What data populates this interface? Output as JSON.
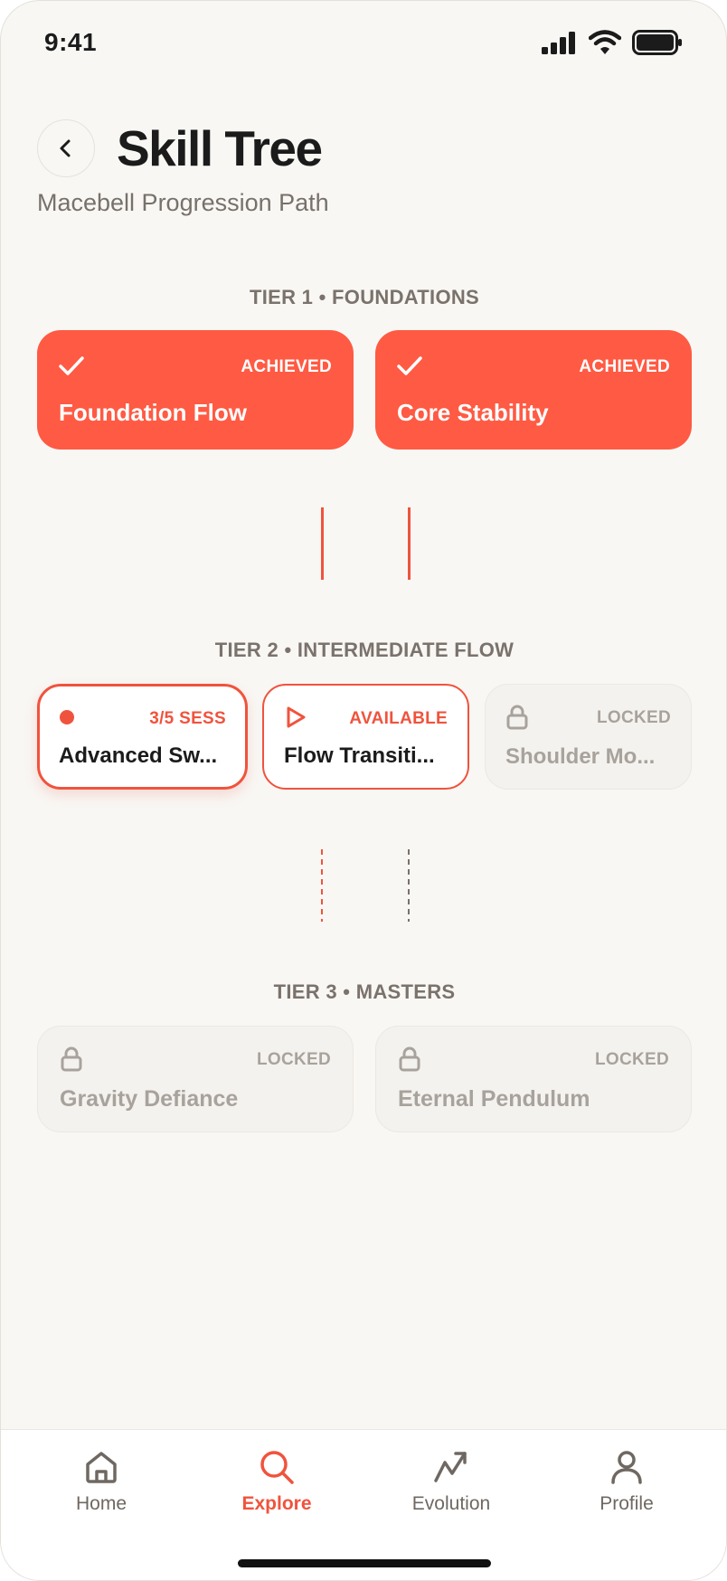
{
  "status_bar": {
    "time": "9:41"
  },
  "header": {
    "title": "Skill Tree",
    "subtitle": "Macebell Progression Path"
  },
  "tiers": [
    {
      "label": "TIER 1 • FOUNDATIONS",
      "cards": [
        {
          "title": "Foundation Flow",
          "status": "ACHIEVED",
          "state": "achieved",
          "icon": "check-icon"
        },
        {
          "title": "Core Stability",
          "status": "ACHIEVED",
          "state": "achieved",
          "icon": "check-icon"
        }
      ]
    },
    {
      "label": "TIER 2 • INTERMEDIATE FLOW",
      "cards": [
        {
          "title": "Advanced Sw...",
          "status": "3/5 SESS",
          "state": "in-progress",
          "icon": "dot-icon"
        },
        {
          "title": "Flow Transiti...",
          "status": "AVAILABLE",
          "state": "available",
          "icon": "play-icon"
        },
        {
          "title": "Shoulder Mo...",
          "status": "LOCKED",
          "state": "locked",
          "icon": "lock-icon"
        }
      ]
    },
    {
      "label": "TIER 3 • MASTERS",
      "cards": [
        {
          "title": "Gravity Defiance",
          "status": "LOCKED",
          "state": "locked",
          "icon": "lock-icon"
        },
        {
          "title": "Eternal Pendulum",
          "status": "LOCKED",
          "state": "locked",
          "icon": "lock-icon"
        }
      ]
    }
  ],
  "nav": {
    "active": "Explore",
    "items": [
      {
        "label": "Home",
        "icon": "home-icon"
      },
      {
        "label": "Explore",
        "icon": "search-icon"
      },
      {
        "label": "Evolution",
        "icon": "trend-icon"
      },
      {
        "label": "Profile",
        "icon": "user-icon"
      }
    ]
  },
  "colors": {
    "accent": "#FF5A43",
    "background": "#F8F7F4",
    "text_primary": "#1B1B1B",
    "text_secondary": "#7A726B",
    "locked_text": "#A8A29C"
  }
}
